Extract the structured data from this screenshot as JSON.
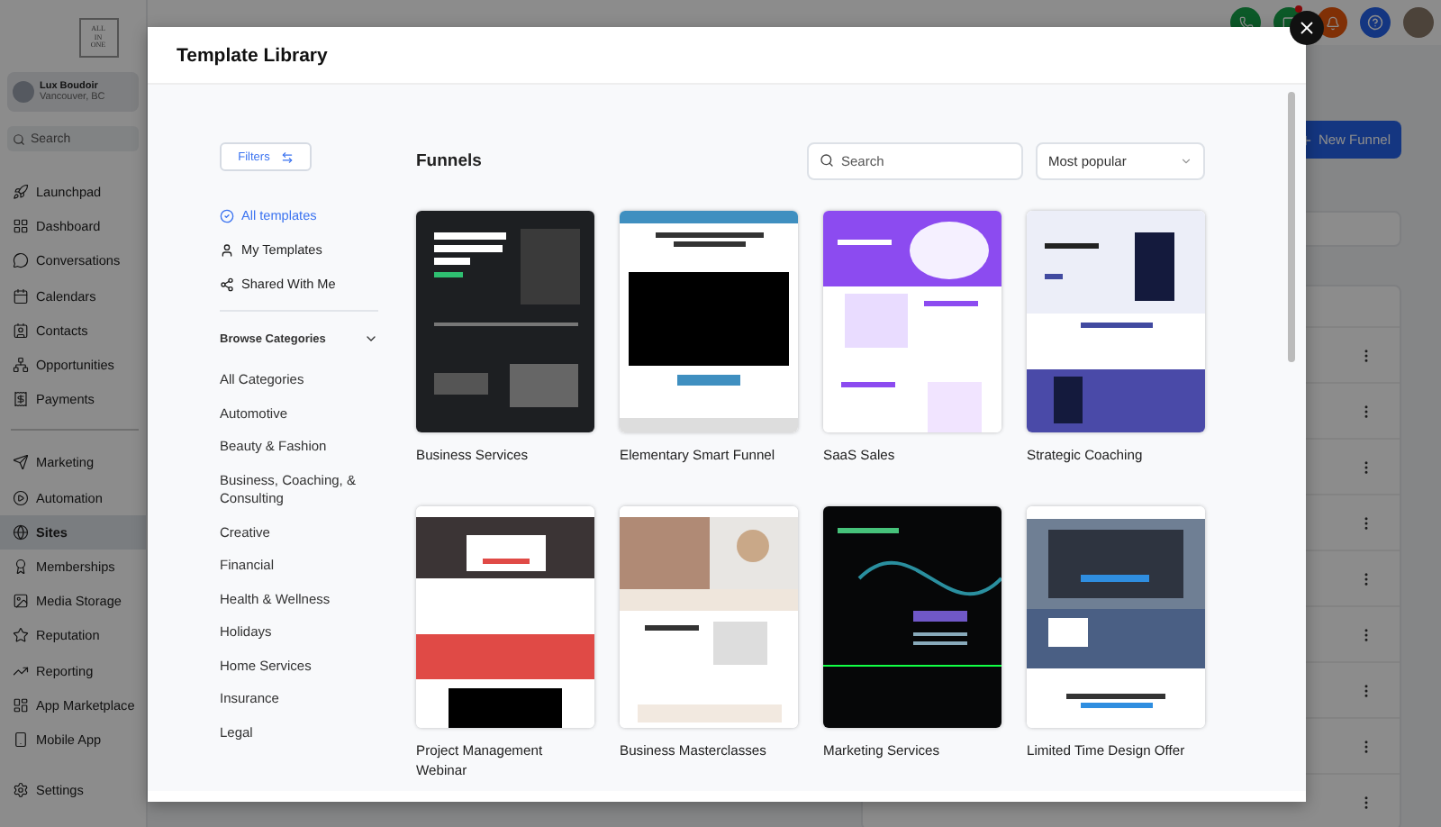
{
  "sidebar": {
    "logo": [
      "ALL",
      "IN",
      "ONE"
    ],
    "account": {
      "name": "Lux Boudoir",
      "location": "Vancouver, BC"
    },
    "search": {
      "placeholder": "Search"
    },
    "groups": [
      [
        {
          "label": "Launchpad",
          "selected": false
        },
        {
          "label": "Dashboard",
          "selected": false
        },
        {
          "label": "Conversations",
          "selected": false
        },
        {
          "label": "Calendars",
          "selected": false
        },
        {
          "label": "Contacts",
          "selected": false
        },
        {
          "label": "Opportunities",
          "selected": false
        },
        {
          "label": "Payments",
          "selected": false
        }
      ],
      [
        {
          "label": "Marketing",
          "selected": false
        },
        {
          "label": "Automation",
          "selected": false
        },
        {
          "label": "Sites",
          "selected": true
        },
        {
          "label": "Memberships",
          "selected": false
        },
        {
          "label": "Media Storage",
          "selected": false
        },
        {
          "label": "Reputation",
          "selected": false
        },
        {
          "label": "Reporting",
          "selected": false
        },
        {
          "label": "App Marketplace",
          "selected": false
        },
        {
          "label": "Mobile App",
          "selected": false
        }
      ]
    ],
    "settings": "Settings"
  },
  "main": {
    "new_button": "New Funnel"
  },
  "modal": {
    "title": "Template Library",
    "filters_button": "Filters",
    "views": [
      {
        "label": "All templates",
        "selected": true
      },
      {
        "label": "My Templates",
        "selected": false
      },
      {
        "label": "Shared With Me",
        "selected": false
      }
    ],
    "browse": {
      "label": "Browse Categories",
      "expanded": true
    },
    "categories": [
      "All Categories",
      "Automotive",
      "Beauty & Fashion",
      "Business, Coaching, & Consulting",
      "Creative",
      "Financial",
      "Health & Wellness",
      "Holidays",
      "Home Services",
      "Insurance",
      "Legal"
    ],
    "section_title": "Funnels",
    "search": {
      "placeholder": "Search"
    },
    "sort": "Most popular",
    "templates": [
      {
        "name": "Business Services",
        "kind": "dark"
      },
      {
        "name": "Elementary Smart Funnel",
        "kind": "video"
      },
      {
        "name": "SaaS Sales",
        "kind": "purple"
      },
      {
        "name": "Strategic Coaching",
        "kind": "book"
      },
      {
        "name": "Project Management Webinar",
        "kind": "red"
      },
      {
        "name": "Business Masterclasses",
        "kind": "beige"
      },
      {
        "name": "Marketing Services",
        "kind": "neon"
      },
      {
        "name": "Limited Time Design Offer",
        "kind": "blue"
      }
    ]
  }
}
